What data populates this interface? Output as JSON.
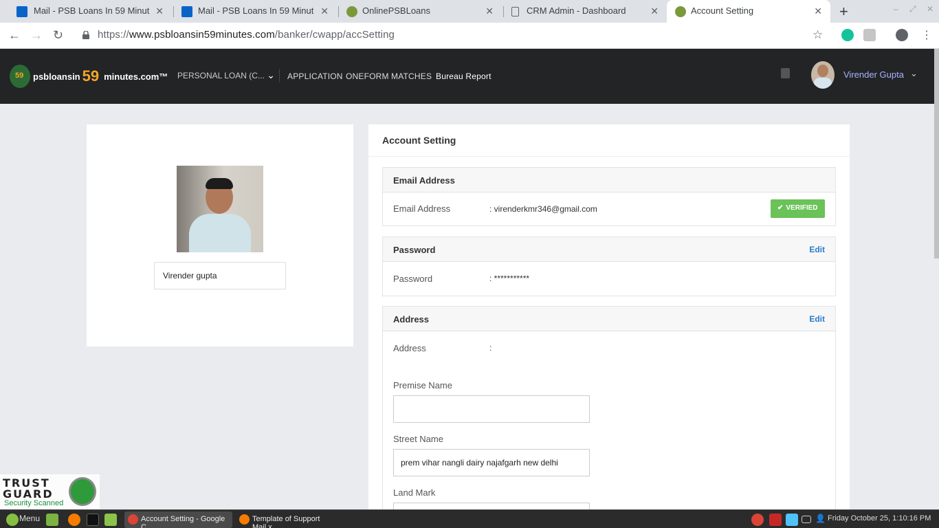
{
  "browser": {
    "tabs": [
      {
        "title": "Mail - PSB Loans In 59 Minut",
        "icon": "outlook-icon"
      },
      {
        "title": "Mail - PSB Loans In 59 Minut",
        "icon": "outlook-icon"
      },
      {
        "title": "OnlinePSBLoans",
        "icon": "psb-icon"
      },
      {
        "title": "CRM Admin - Dashboard",
        "icon": "page-icon"
      },
      {
        "title": "Account Setting",
        "icon": "psb-icon"
      }
    ],
    "url_prefix": "https://",
    "url_domain": "www.psbloansin59minutes.com",
    "url_path": "/banker/cwapp/accSetting"
  },
  "header": {
    "logo_small": "59",
    "logo_text_a": "psbloansin",
    "logo_59": "59",
    "logo_text_b": "minutes.com™",
    "loan_dropdown": "PERSONAL LOAN (C...",
    "nav": [
      "APPLICATION",
      "ONEFORM",
      "MATCHES",
      "Bureau Report"
    ],
    "user_name": "Virender Gupta"
  },
  "profile": {
    "name": "Virender gupta"
  },
  "account": {
    "title": "Account Setting",
    "email": {
      "heading": "Email Address",
      "label": "Email Address",
      "value": ": virenderkmr346@gmail.com",
      "badge": "VERIFIED"
    },
    "password": {
      "heading": "Password",
      "edit": "Edit",
      "label": "Password",
      "value": ": ***********"
    },
    "address": {
      "heading": "Address",
      "edit": "Edit",
      "label": "Address",
      "value": ":",
      "premise_label": "Premise Name",
      "premise_value": "",
      "street_label": "Street Name",
      "street_value": "prem vihar nangli dairy najafgarh new delhi",
      "landmark_label": "Land Mark"
    }
  },
  "trust_guard": {
    "line1": "TRUST",
    "line2": "GUARD",
    "line3": "Security Scanned"
  },
  "taskbar": {
    "menu": "Menu",
    "windows": [
      "Account Setting - Google C...",
      "Template  of Support Mail.x..."
    ],
    "clock": "Friday October 25,  1:10:16 PM"
  },
  "colors": {
    "header_bg": "#222426",
    "verified_green": "#6ac259",
    "edit_blue": "#2a7cc8",
    "logo_orange": "#f5a623"
  }
}
